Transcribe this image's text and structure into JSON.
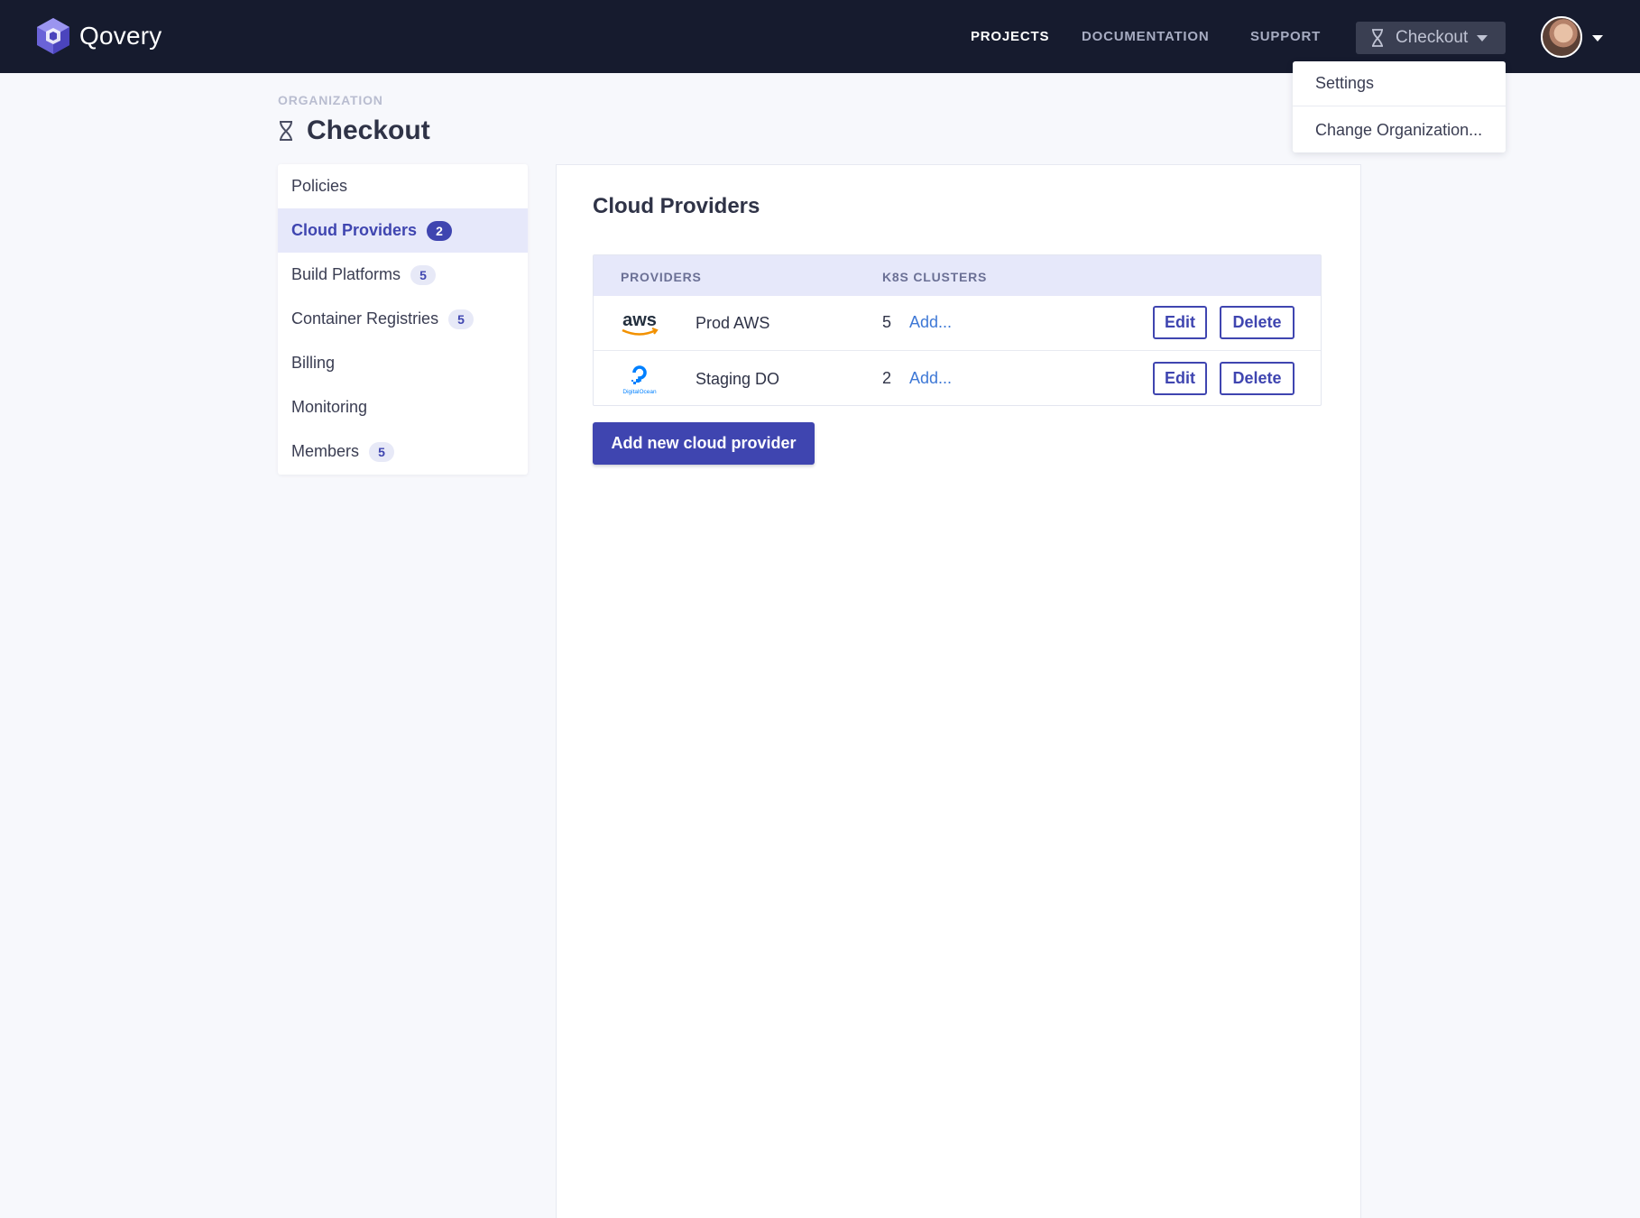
{
  "brand": {
    "name": "Qovery"
  },
  "nav": {
    "links": [
      {
        "label": "PROJECTS",
        "active": true
      },
      {
        "label": "DOCUMENTATION",
        "active": false
      },
      {
        "label": "SUPPORT",
        "active": false
      }
    ],
    "org_selector": {
      "label": "Checkout",
      "icon": "organization-glyph-icon"
    },
    "user_menu": {
      "icon": "avatar"
    }
  },
  "org_dropdown": {
    "items": [
      {
        "label": "Settings"
      },
      {
        "label": "Change Organization..."
      }
    ]
  },
  "header": {
    "eyebrow": "ORGANIZATION",
    "title": "Checkout"
  },
  "sidebar": {
    "items": [
      {
        "label": "Policies",
        "badge": null,
        "active": false
      },
      {
        "label": "Cloud Providers",
        "badge": "2",
        "active": true
      },
      {
        "label": "Build Platforms",
        "badge": "5",
        "active": false
      },
      {
        "label": "Container Registries",
        "badge": "5",
        "active": false
      },
      {
        "label": "Billing",
        "badge": null,
        "active": false
      },
      {
        "label": "Monitoring",
        "badge": null,
        "active": false
      },
      {
        "label": "Members",
        "badge": "5",
        "active": false
      }
    ]
  },
  "main": {
    "title": "Cloud Providers",
    "table": {
      "headers": {
        "providers": "PROVIDERS",
        "clusters": "K8S CLUSTERS"
      },
      "rows": [
        {
          "logo": "aws-logo-icon",
          "logo_text": "aws",
          "name": "Prod AWS",
          "clusters": "5",
          "add_label": "Add...",
          "edit_label": "Edit",
          "delete_label": "Delete"
        },
        {
          "logo": "digitalocean-logo-icon",
          "logo_text": "DigitalOcean",
          "name": "Staging DO",
          "clusters": "2",
          "add_label": "Add...",
          "edit_label": "Edit",
          "delete_label": "Delete"
        }
      ]
    },
    "add_button": "Add new cloud provider"
  },
  "colors": {
    "topbar": "#161b2e",
    "accent": "#3f45b0",
    "link": "#3e78d6",
    "active_row": "#e6e8fa",
    "page_bg": "#f7f8fc"
  }
}
